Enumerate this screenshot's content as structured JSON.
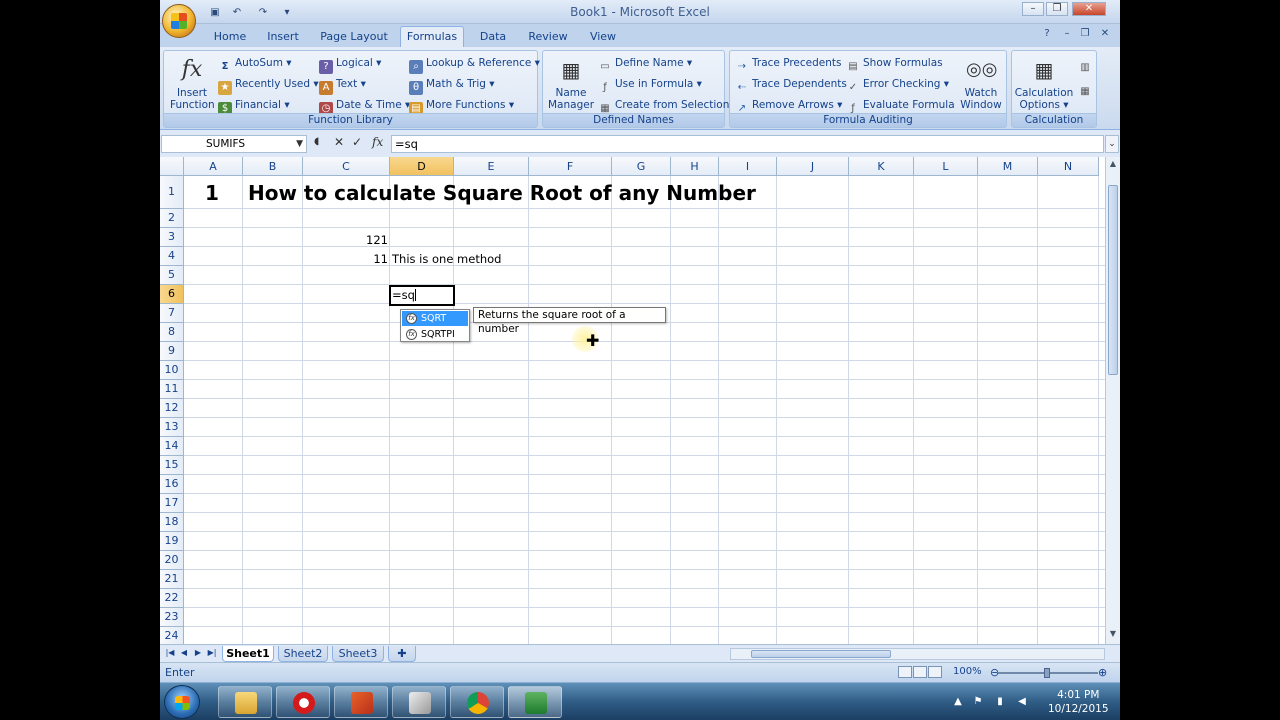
{
  "window": {
    "title": "Book1 - Microsoft Excel"
  },
  "tabs": [
    "Home",
    "Insert",
    "Page Layout",
    "Formulas",
    "Data",
    "Review",
    "View"
  ],
  "active_tab": "Formulas",
  "ribbon": {
    "insert_function": {
      "line1": "Insert",
      "line2": "Function"
    },
    "function_library": {
      "label": "Function Library",
      "items": [
        "AutoSum ▾",
        "Recently Used ▾",
        "Financial ▾",
        "Logical ▾",
        "Text ▾",
        "Date & Time ▾",
        "Lookup & Reference ▾",
        "Math & Trig ▾",
        "More Functions ▾"
      ]
    },
    "defined_names": {
      "label": "Defined Names",
      "name_manager": {
        "line1": "Name",
        "line2": "Manager"
      },
      "items": [
        "Define Name ▾",
        "Use in Formula ▾",
        "Create from Selection"
      ]
    },
    "formula_auditing": {
      "label": "Formula Auditing",
      "items": [
        "Trace Precedents",
        "Trace Dependents",
        "Remove Arrows ▾",
        "Show Formulas",
        "Error Checking ▾",
        "Evaluate Formula"
      ],
      "watch_window": {
        "line1": "Watch",
        "line2": "Window"
      }
    },
    "calculation": {
      "label": "Calculation",
      "options": {
        "line1": "Calculation",
        "line2": "Options ▾"
      }
    }
  },
  "formula_bar": {
    "name_box": "SUMIFS",
    "formula": "=sq",
    "fx": "fx"
  },
  "columns": [
    "A",
    "B",
    "C",
    "D",
    "E",
    "F",
    "G",
    "H",
    "I",
    "J",
    "K",
    "L",
    "M",
    "N"
  ],
  "selected_column": "D",
  "rows": [
    "1",
    "2",
    "3",
    "4",
    "5",
    "6",
    "7",
    "8",
    "9",
    "10",
    "11",
    "12",
    "13",
    "14",
    "15",
    "16",
    "17",
    "18",
    "19",
    "20",
    "21",
    "22",
    "23",
    "24"
  ],
  "selected_row": "6",
  "cells": {
    "A1": "1",
    "B1": "How to calculate Square Root of any Number",
    "C3": "121",
    "C4": "11",
    "D4": "This is one method",
    "D6": "=sq"
  },
  "autocomplete": {
    "items": [
      "SQRT",
      "SQRTPI"
    ],
    "selected": "SQRT",
    "tooltip": "Returns the square root of a number"
  },
  "sheets": [
    "Sheet1",
    "Sheet2",
    "Sheet3"
  ],
  "active_sheet": "Sheet1",
  "status": {
    "mode": "Enter",
    "zoom": "100%"
  },
  "taskbar": {
    "time": "4:01 PM",
    "date": "10/12/2015"
  }
}
